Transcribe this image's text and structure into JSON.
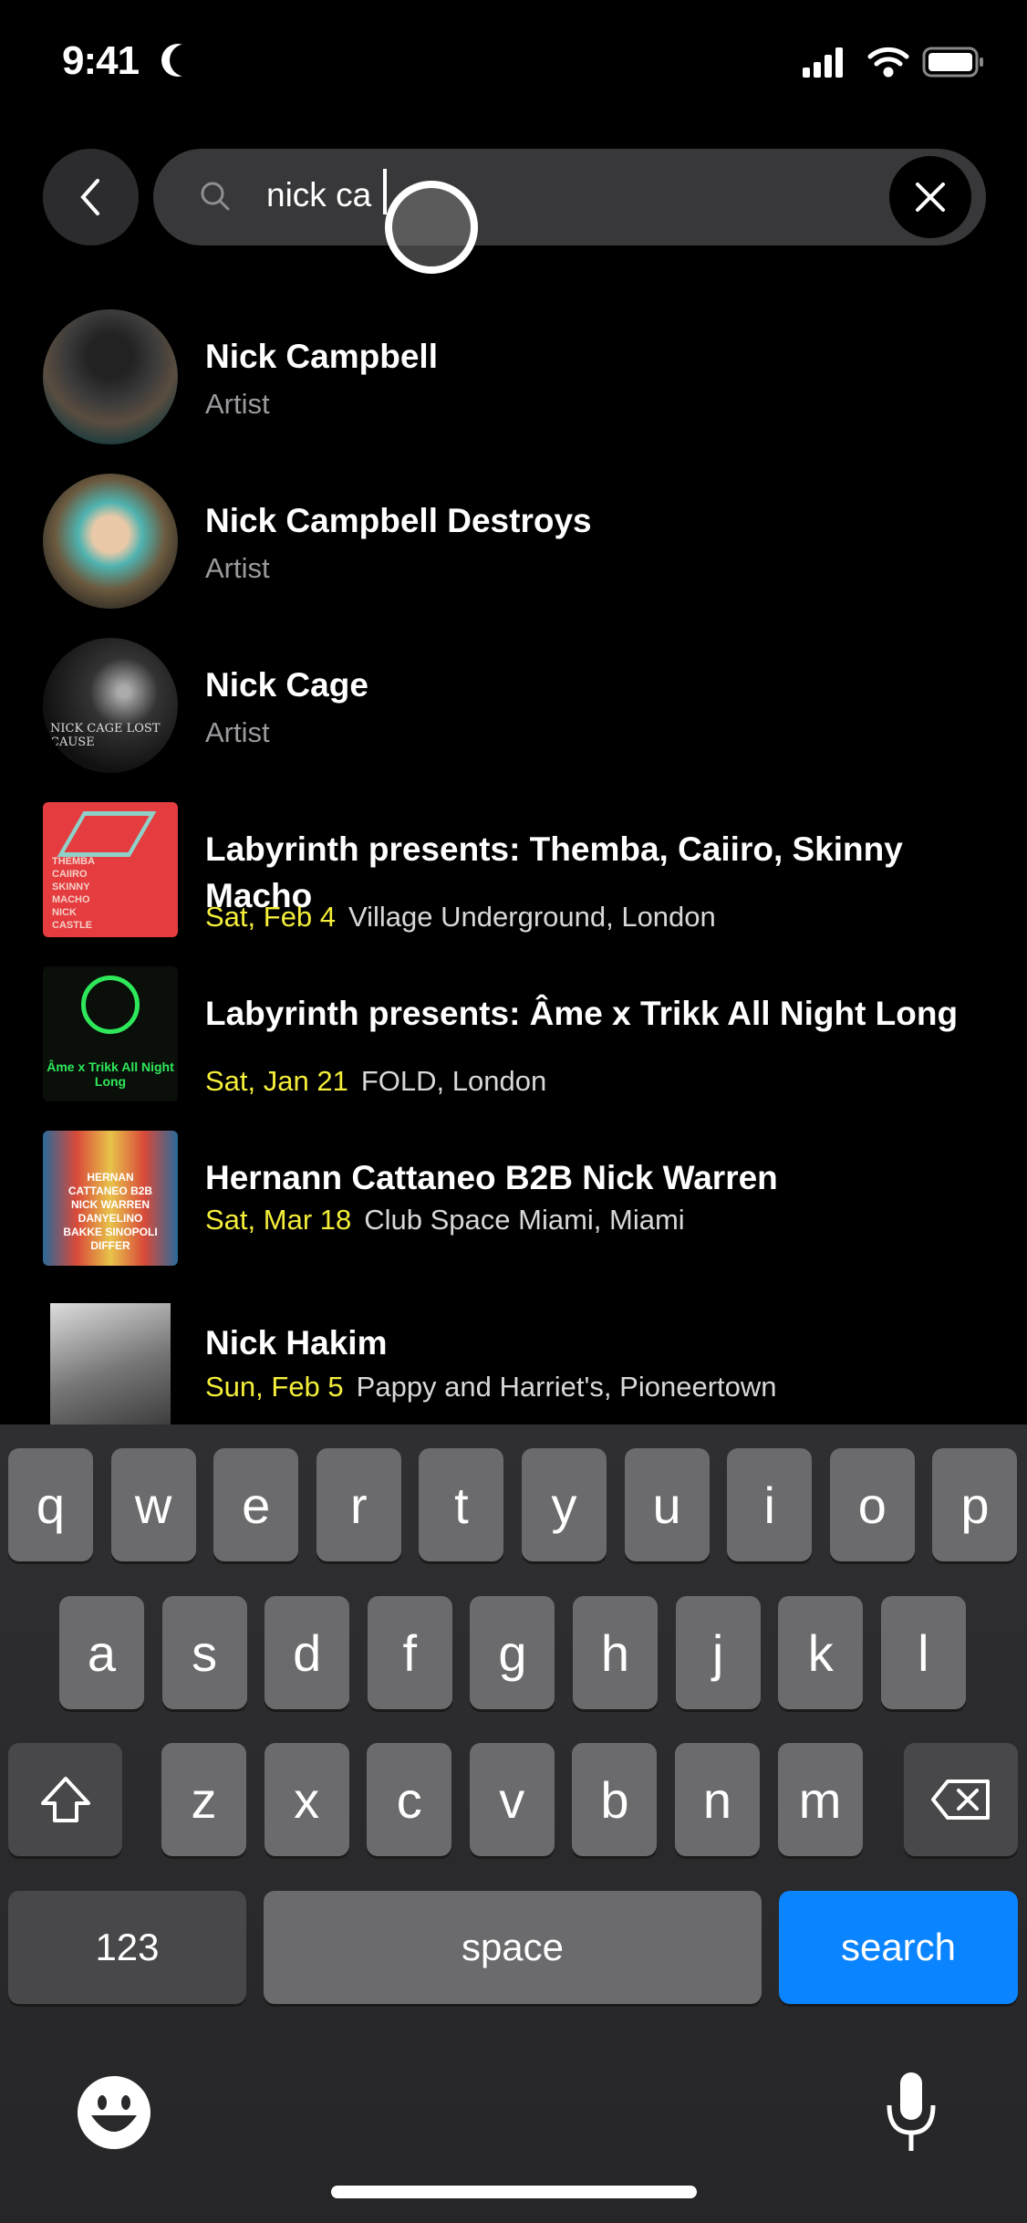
{
  "status_bar": {
    "time": "9:41",
    "icons": [
      "moon-icon",
      "signal-icon",
      "wifi-icon",
      "battery-icon"
    ]
  },
  "search": {
    "query": "nick ca",
    "back_icon": "chevron-left-icon",
    "search_icon": "search-icon",
    "clear_icon": "close-icon"
  },
  "results": [
    {
      "title": "Nick Campbell",
      "subtitle": "Artist",
      "type": "artist"
    },
    {
      "title": "Nick Campbell Destroys",
      "subtitle": "Artist",
      "type": "artist"
    },
    {
      "title": "Nick Cage",
      "subtitle": "Artist",
      "type": "artist",
      "thumb_text": "NICK CAGE LOST CAUSE"
    },
    {
      "title": "Labyrinth presents: Themba, Caiiro, Skinny Macho",
      "date": "Sat, Feb 4",
      "venue": "Village Underground, London",
      "type": "event",
      "thumb_text": "THEMBA CAIIRO SKINNY MACHO NICK CASTLE"
    },
    {
      "title": "Labyrinth presents: Âme x Trikk All Night Long",
      "date": "Sat, Jan 21",
      "venue": "FOLD, London",
      "type": "event",
      "thumb_text": "Âme x Trikk All Night Long"
    },
    {
      "title": "Hernann Cattaneo B2B Nick Warren",
      "date": "Sat, Mar 18",
      "venue": "Club Space Miami, Miami",
      "type": "event",
      "thumb_text": "HERNAN CATTANEO B2B NICK WARREN DANYELINO BAKKE SINOPOLI DIFFER"
    },
    {
      "title": "Nick Hakim",
      "date": "Sun, Feb 5",
      "venue": "Pappy and Harriet's, Pioneertown",
      "type": "event"
    }
  ],
  "colors": {
    "accent_date": "#f4ee3a",
    "search_key": "#0a84ff",
    "background": "#000000"
  },
  "keyboard": {
    "row1": [
      "q",
      "w",
      "e",
      "r",
      "t",
      "y",
      "u",
      "i",
      "o",
      "p"
    ],
    "row2": [
      "a",
      "s",
      "d",
      "f",
      "g",
      "h",
      "j",
      "k",
      "l"
    ],
    "row3": [
      "z",
      "x",
      "c",
      "v",
      "b",
      "n",
      "m"
    ],
    "numbers": "123",
    "space": "space",
    "search": "search",
    "icons": [
      "shift-icon",
      "delete-icon",
      "emoji-icon",
      "microphone-icon"
    ]
  }
}
